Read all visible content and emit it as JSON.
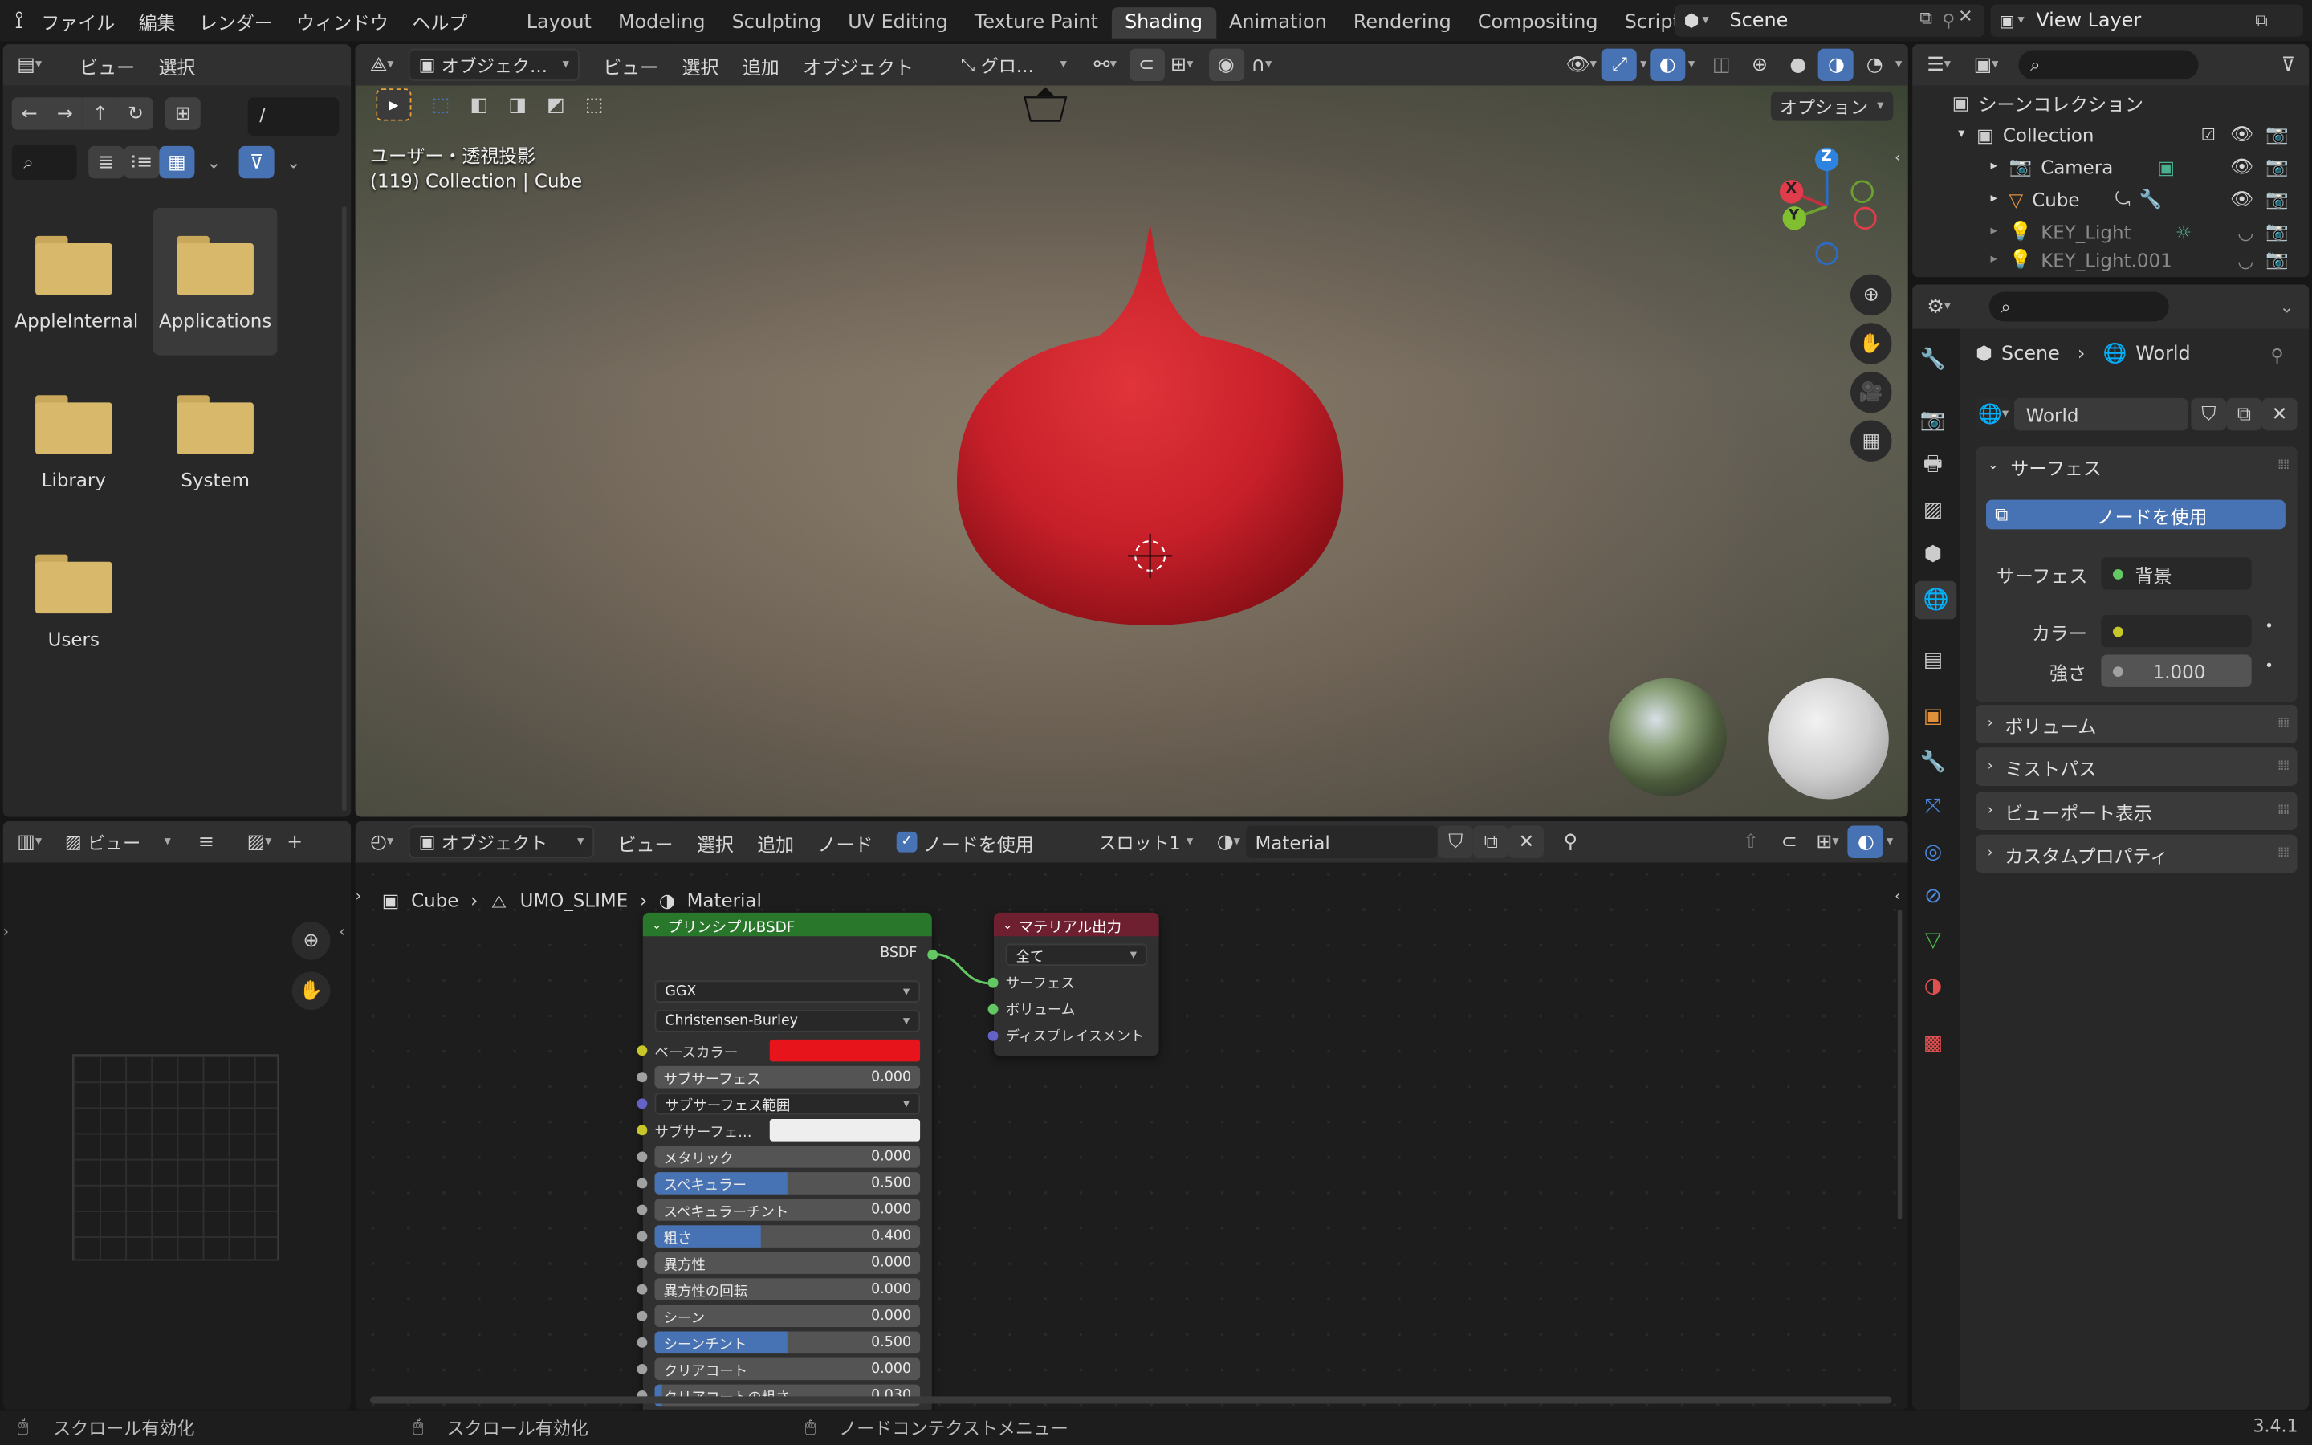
{
  "topbar": {
    "menus": [
      "ファイル",
      "編集",
      "レンダー",
      "ウィンドウ",
      "ヘルプ"
    ],
    "workspaces": [
      "Layout",
      "Modeling",
      "Sculpting",
      "UV Editing",
      "Texture Paint",
      "Shading",
      "Animation",
      "Rendering",
      "Compositing",
      "Scripting"
    ],
    "active_workspace": "Shading",
    "scene": "Scene",
    "view_layer": "View Layer"
  },
  "file_browser": {
    "menus": [
      "ビュー",
      "選択"
    ],
    "path": "/",
    "folders": [
      "AppleInternal",
      "Applications",
      "Library",
      "System",
      "Users"
    ],
    "selected_folder": "Applications"
  },
  "viewport": {
    "mode": "オブジェク…",
    "menus": [
      "ビュー",
      "選択",
      "追加",
      "オブジェクト"
    ],
    "transform_orientation": "グロ…",
    "options": "オプション",
    "view_name": "ユーザー・透視投影",
    "collection_info": "(119) Collection | Cube",
    "gizmo": {
      "x": "X",
      "y": "Y",
      "z": "Z"
    }
  },
  "image_editor": {
    "menu": "ビュー"
  },
  "node_editor": {
    "mode": "オブジェクト",
    "menus": [
      "ビュー",
      "選択",
      "追加",
      "ノード"
    ],
    "use_nodes": "ノードを使用",
    "slot": "スロット1",
    "material": "Material",
    "breadcrumb": [
      "Cube",
      "UMO_SLIME",
      "Material"
    ]
  },
  "bsdf_node": {
    "title": "プリンシプルBSDF",
    "output": "BSDF",
    "distribution": "GGX",
    "subsurface_method": "Christensen-Burley",
    "base_color_label": "ベースカラー",
    "base_color": "#e8141c",
    "subsurface_label": "サブサーフェス",
    "subsurface": "0.000",
    "subsurface_radius": "サブサーフェス範囲",
    "subsurface_color_label": "サブサーフェ…",
    "subsurface_color": "#eeeeee",
    "rows": [
      {
        "label": "メタリック",
        "value": "0.000",
        "fill": 0
      },
      {
        "label": "スペキュラー",
        "value": "0.500",
        "fill": 0.5
      },
      {
        "label": "スペキュラーチント",
        "value": "0.000",
        "fill": 0
      },
      {
        "label": "粗さ",
        "value": "0.400",
        "fill": 0.4
      },
      {
        "label": "異方性",
        "value": "0.000",
        "fill": 0
      },
      {
        "label": "異方性の回転",
        "value": "0.000",
        "fill": 0
      },
      {
        "label": "シーン",
        "value": "0.000",
        "fill": 0
      },
      {
        "label": "シーンチント",
        "value": "0.500",
        "fill": 0.5
      },
      {
        "label": "クリアコート",
        "value": "0.000",
        "fill": 0
      },
      {
        "label": "クリアコートの粗さ",
        "value": "0.030",
        "fill": 0.03
      }
    ]
  },
  "output_node": {
    "title": "マテリアル出力",
    "target": "全て",
    "inputs": [
      "サーフェス",
      "ボリューム",
      "ディスプレイスメント"
    ]
  },
  "outliner": {
    "root": "シーンコレクション",
    "collection": "Collection",
    "items": [
      "Camera",
      "Cube",
      "KEY_Light",
      "KEY_Light.001"
    ]
  },
  "properties": {
    "breadcrumb": [
      "Scene",
      "World"
    ],
    "world_name": "World",
    "surface_panel": "サーフェス",
    "use_nodes_button": "ノードを使用",
    "surface_label": "サーフェス",
    "surface_value": "背景",
    "color_label": "カラー",
    "strength_label": "強さ",
    "strength_value": "1.000",
    "collapsed_panels": [
      "ボリューム",
      "ミストパス",
      "ビューポート表示",
      "カスタムプロパティ"
    ]
  },
  "statusbar": {
    "left": "スクロール有効化",
    "middle": "スクロール有効化",
    "right": "ノードコンテクストメニュー",
    "version": "3.4.1"
  }
}
